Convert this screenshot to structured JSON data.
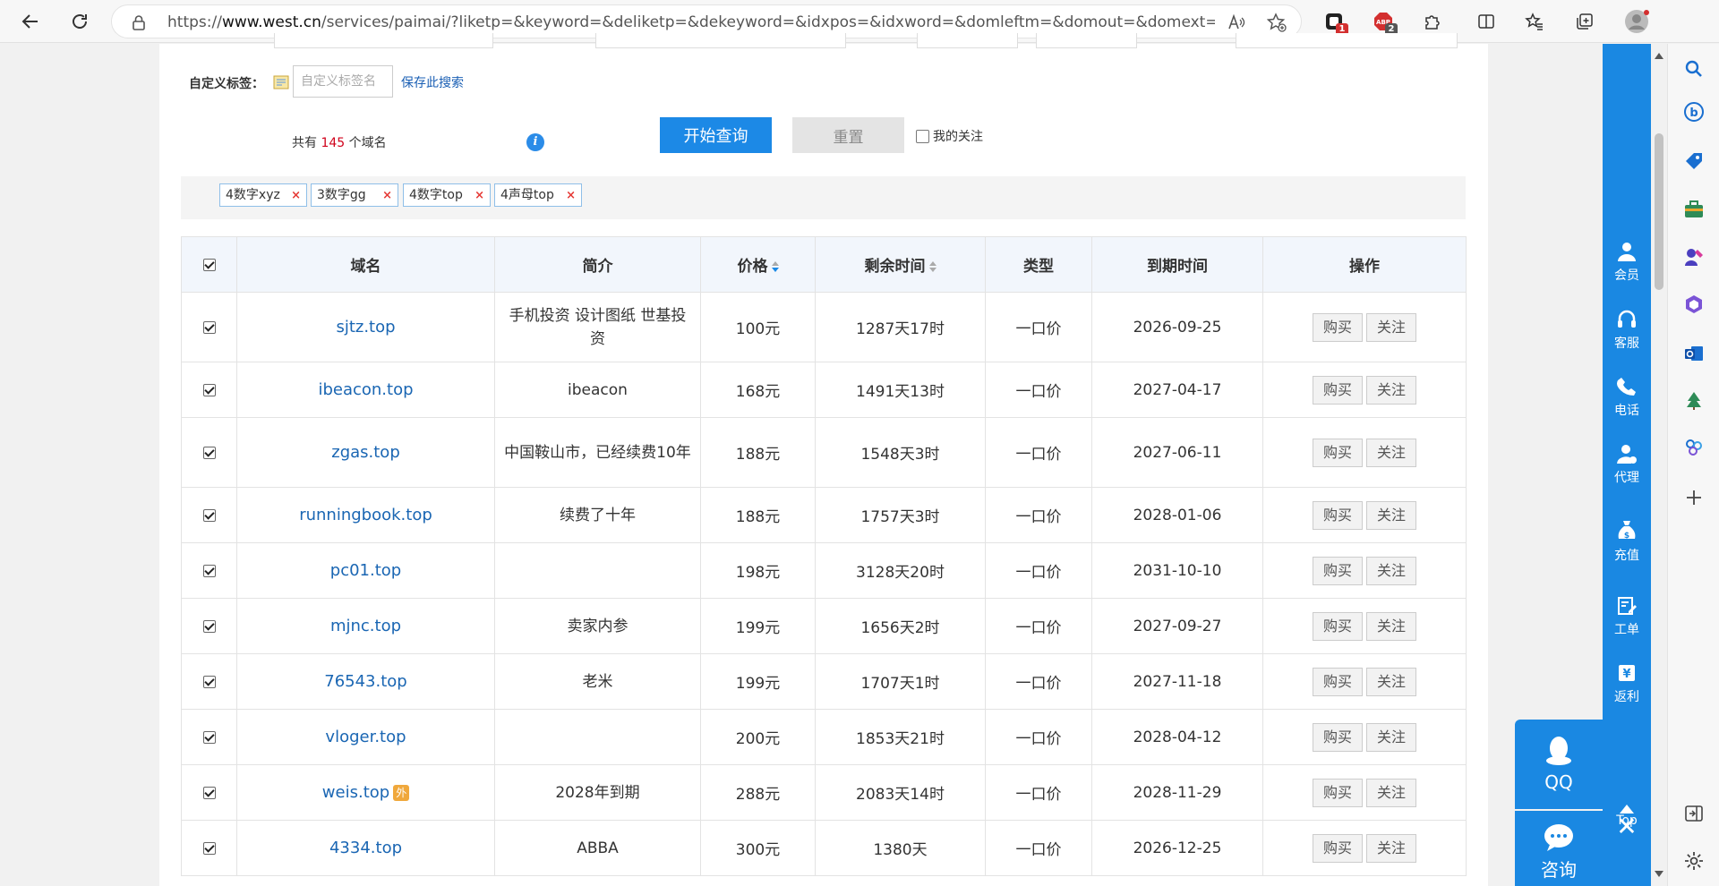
{
  "browser": {
    "url_scheme": "https://",
    "url_host": "www.west.cn",
    "url_path": "/services/paimai/?liketp=&keyword=&deliketp=&dekeyword=&idxpos=&idxword=&domleftm=&domout=&domext=top&sear...",
    "ext_badge_1": "1",
    "ext_badge_2": "2"
  },
  "filters": {
    "custom_tag_label": "自定义标签：",
    "custom_tag_placeholder": "自定义标签名",
    "save_search_label": "保存此搜索",
    "count_prefix": "共有",
    "count_value": "145",
    "count_suffix": "个域名",
    "info_icon_text": "i",
    "search_button": "开始查询",
    "reset_button": "重置",
    "my_follow_label": "我的关注",
    "tags": [
      {
        "label": "4数字xyz",
        "close": "×"
      },
      {
        "label": "3数字gg",
        "close": "×"
      },
      {
        "label": "4数字top",
        "close": "×"
      },
      {
        "label": "4声母top",
        "close": "×"
      }
    ]
  },
  "table": {
    "headers": {
      "domain": "域名",
      "desc": "简介",
      "price": "价格",
      "remaining": "剩余时间",
      "type": "类型",
      "expiry": "到期时间",
      "action": "操作"
    },
    "buy_label": "购买",
    "follow_label": "关注",
    "ext_flag": "外",
    "rows": [
      {
        "domain": "sjtz.top",
        "desc": "手机投资 设计图纸 世基投资",
        "price": "100元",
        "remaining": "1287天17时",
        "type": "一口价",
        "expiry": "2026-09-25"
      },
      {
        "domain": "ibeacon.top",
        "desc": "ibeacon",
        "price": "168元",
        "remaining": "1491天13时",
        "type": "一口价",
        "expiry": "2027-04-17"
      },
      {
        "domain": "zgas.top",
        "desc": "中国鞍山市，已经续费10年",
        "price": "188元",
        "remaining": "1548天3时",
        "type": "一口价",
        "expiry": "2027-06-11"
      },
      {
        "domain": "runningbook.top",
        "desc": "续费了十年",
        "price": "188元",
        "remaining": "1757天3时",
        "type": "一口价",
        "expiry": "2028-01-06"
      },
      {
        "domain": "pc01.top",
        "desc": "",
        "price": "198元",
        "remaining": "3128天20时",
        "type": "一口价",
        "expiry": "2031-10-10"
      },
      {
        "domain": "mjnc.top",
        "desc": "卖家内参",
        "price": "199元",
        "remaining": "1656天2时",
        "type": "一口价",
        "expiry": "2027-09-27"
      },
      {
        "domain": "76543.top",
        "desc": "老米",
        "price": "199元",
        "remaining": "1707天1时",
        "type": "一口价",
        "expiry": "2027-11-18"
      },
      {
        "domain": "vloger.top",
        "desc": "",
        "price": "200元",
        "remaining": "1853天21时",
        "type": "一口价",
        "expiry": "2028-04-12"
      },
      {
        "domain": "weis.top",
        "desc": "2028年到期",
        "price": "288元",
        "remaining": "2083天14时",
        "type": "一口价",
        "expiry": "2028-11-29"
      },
      {
        "domain": "4334.top",
        "desc": "ABBA",
        "price": "300元",
        "remaining": "1380天",
        "type": "一口价",
        "expiry": "2026-12-25"
      }
    ]
  },
  "side_toolbar": {
    "items": [
      "会员",
      "客服",
      "电话",
      "代理",
      "充值",
      "工单",
      "返利"
    ],
    "top_label": "Top",
    "close_label": "✕",
    "qq_label": "QQ",
    "consult_label": "咨询"
  },
  "colors": {
    "accent": "#1c89e6",
    "price": "#e0391d",
    "link": "#1a66b3",
    "count": "#d0021b"
  }
}
